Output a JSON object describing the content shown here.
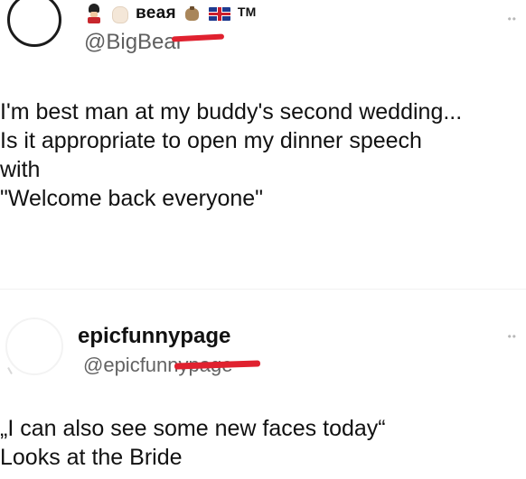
{
  "posts": [
    {
      "display_name": "веая",
      "trademark": "TM",
      "handle": "@BigBear"
    },
    {
      "display_name": "epicfunnypage",
      "handle": "@epicfunnypage"
    }
  ],
  "post1_lines": [
    "I'm best man at my buddy's second wedding...",
    "Is it appropriate to open my dinner speech",
    "with",
    "\"Welcome back everyone\""
  ],
  "post2_lines": [
    "„I can also see some new faces today“",
    "Looks at the Bride"
  ],
  "icons": {
    "post1_badges": [
      "guard-icon",
      "hand-icon",
      "money-bag-icon",
      "uk-flag-icon"
    ]
  },
  "colors": {
    "redaction": "#e0212f"
  }
}
